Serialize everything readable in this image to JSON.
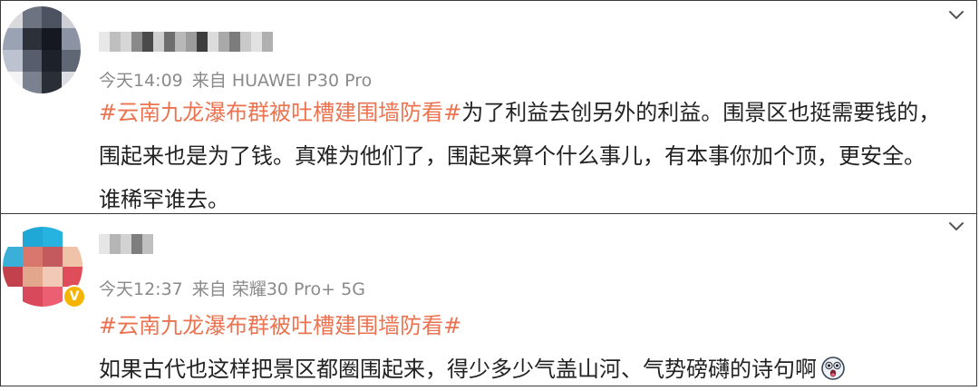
{
  "comments": [
    {
      "timestamp": "今天14:09",
      "source_label": "来自",
      "device": "HUAWEI P30 Pro",
      "hashtag": "#云南九龙瀑布群被吐槽建围墙防看#",
      "line1_rest": "为了利益去创另外的利益。围景区也挺需要钱的，",
      "line2": "围起来也是为了钱。真难为他们了，围起来算个什么事儿，有本事你加个顶，更安全。",
      "line3": "谁稀罕谁去。",
      "avatar_colors": [
        "#d9d9de",
        "#6b7480",
        "#4c5260",
        "#cfd0d6",
        "#9aa3b4",
        "#2c3038",
        "#151821",
        "#8c93a3",
        "#bcc2cf",
        "#565d6c",
        "#1d212a",
        "#606774",
        "#f4f4f6",
        "#7b828f",
        "#2a2e36",
        "#dcdde2"
      ],
      "username_colors": [
        "#e8e8e8",
        "#bfbfbf",
        "#d6d6d6",
        "#8a8a8a",
        "#4a4a4a",
        "#cfcfcf",
        "#6e6e6e",
        "#b8b8b8",
        "#9c9c9c",
        "#3d3d3d",
        "#dcdcdc",
        "#a9a9a9",
        "#7c7c7c",
        "#c9c9c9",
        "#e2e2e2",
        "#b0b0b0"
      ]
    },
    {
      "timestamp": "今天12:37",
      "source_label": "来自",
      "device": "荣耀30 Pro+ 5G",
      "hashtag": "#云南九龙瀑布群被吐槽建围墙防看#",
      "line1": "如果古代也这样把景区都圈围起来，得少多少气盖山河、气势磅礴的诗句啊",
      "emoji": "surprised-face-emoji",
      "avatar_colors": [
        "#ffffff",
        "#1fa7d6",
        "#26b3e0",
        "#ffffff",
        "#3ab0d8",
        "#d9776e",
        "#c55a5e",
        "#f0c3a9",
        "#c2414c",
        "#e2a68c",
        "#f2c9b6",
        "#e04d5a",
        "#ffffff",
        "#d8495c",
        "#ec5f73",
        "#ffffff"
      ],
      "username_colors": [
        "#e6e6e6",
        "#b5b5b5",
        "#d2d2d2",
        "#7e7e7e",
        "#c0c0c0"
      ]
    }
  ],
  "colors": {
    "hashtag": "#eb7350",
    "meta": "#8a8a8a",
    "verified": "#f5b400"
  }
}
